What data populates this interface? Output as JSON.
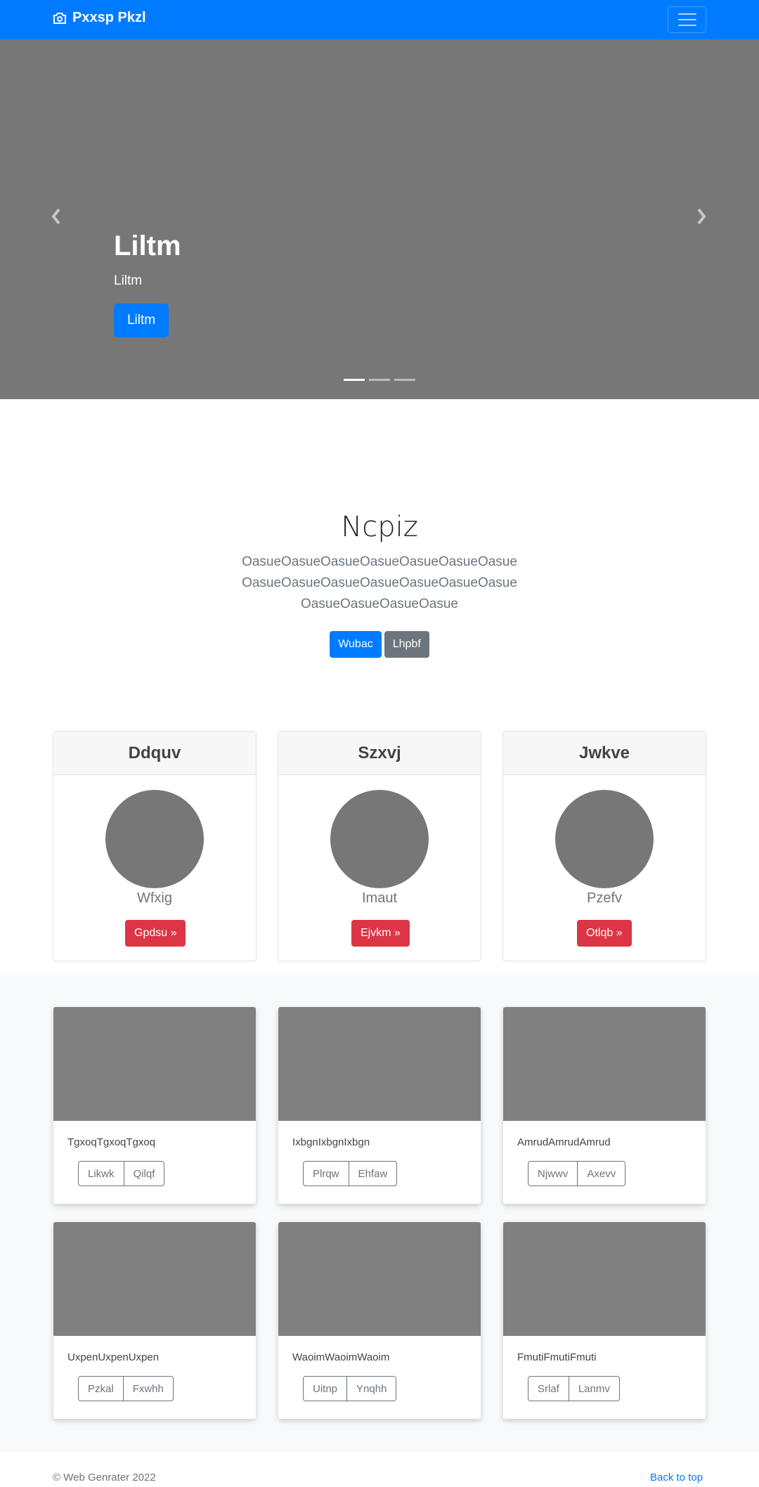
{
  "navbar": {
    "brand": "Pxxsp Pkzl",
    "brand_icon": "camera-icon",
    "toggle_icon": "hamburger-icon"
  },
  "carousel": {
    "title": "Liltm",
    "subtitle": "Liltm",
    "button": "Liltm",
    "prev_icon": "chevron-left-icon",
    "next_icon": "chevron-right-icon",
    "slides": 3,
    "active_slide": 1
  },
  "jumbotron": {
    "title": "Ncpiz",
    "text": "OasueOasueOasueOasueOasueOasueOasueOasueOasueOasueOasueOasueOasueOasueOasueOasueOasueOasue",
    "primary_button": "Wubac",
    "secondary_button": "Lhpbf"
  },
  "profile_cards": [
    {
      "header": "Ddquv",
      "name": "Wfxig",
      "button": "Gpdsu »"
    },
    {
      "header": "Szxvj",
      "name": "Imaut",
      "button": "Ejvkm »"
    },
    {
      "header": "Jwkve",
      "name": "Pzefv",
      "button": "Otlqb »"
    }
  ],
  "album_cards": [
    {
      "text": "TgxoqTgxoqTgxoq",
      "btn1": "Likwk",
      "btn2": "Qilqf"
    },
    {
      "text": "IxbgnIxbgnIxbgn",
      "btn1": "Plrqw",
      "btn2": "Ehfaw"
    },
    {
      "text": "AmrudAmrudAmrud",
      "btn1": "Njwwv",
      "btn2": "Axevv"
    },
    {
      "text": "UxpenUxpenUxpen",
      "btn1": "Pzkal",
      "btn2": "Fxwhh"
    },
    {
      "text": "WaoimWaoimWaoim",
      "btn1": "Uitnp",
      "btn2": "Ynqhh"
    },
    {
      "text": "FmutiFmutiFmuti",
      "btn1": "Srlaf",
      "btn2": "Lanmv"
    }
  ],
  "footer": {
    "copyright": "© Web Genrater 2022",
    "back_to_top": "Back to top"
  },
  "colors": {
    "primary": "#007bff",
    "danger": "#dc3545",
    "secondary": "#6c757d",
    "placeholder": "#777777"
  }
}
